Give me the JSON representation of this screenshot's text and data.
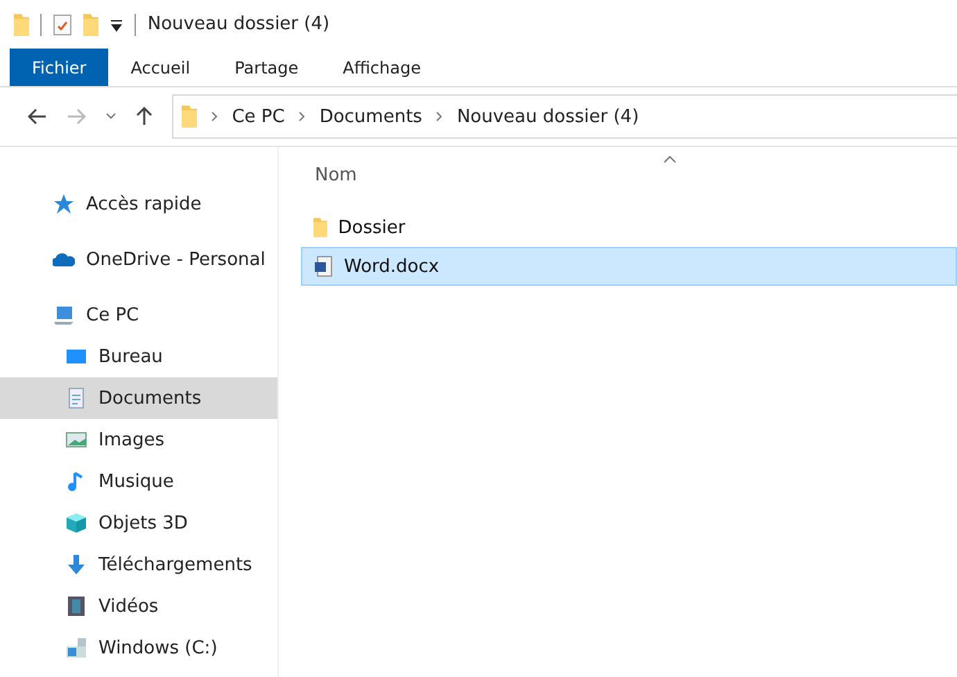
{
  "window": {
    "title": "Nouveau dossier (4)"
  },
  "ribbon_tabs": [
    {
      "label": "Fichier",
      "selected": true
    },
    {
      "label": "Accueil",
      "selected": false
    },
    {
      "label": "Partage",
      "selected": false
    },
    {
      "label": "Affichage",
      "selected": false
    }
  ],
  "breadcrumb": [
    "Ce PC",
    "Documents",
    "Nouveau dossier (4)"
  ],
  "sidebar": {
    "items": [
      {
        "label": "Accès rapide",
        "kind": "star",
        "selected": false
      },
      {
        "label": "OneDrive - Personal",
        "kind": "cloud",
        "selected": false
      },
      {
        "label": "Ce PC",
        "kind": "pc",
        "selected": false,
        "children": [
          {
            "label": "Bureau",
            "kind": "desktop",
            "selected": false
          },
          {
            "label": "Documents",
            "kind": "documents",
            "selected": true
          },
          {
            "label": "Images",
            "kind": "images",
            "selected": false
          },
          {
            "label": "Musique",
            "kind": "music",
            "selected": false
          },
          {
            "label": "Objets 3D",
            "kind": "cube",
            "selected": false
          },
          {
            "label": "Téléchargements",
            "kind": "download",
            "selected": false
          },
          {
            "label": "Vidéos",
            "kind": "video",
            "selected": false
          },
          {
            "label": "Windows (C:)",
            "kind": "drive",
            "selected": false
          }
        ]
      }
    ]
  },
  "file_list": {
    "column": "Nom",
    "rows": [
      {
        "name": "Dossier",
        "kind": "folder",
        "selected": false
      },
      {
        "name": "Word.docx",
        "kind": "word",
        "selected": true
      }
    ]
  }
}
